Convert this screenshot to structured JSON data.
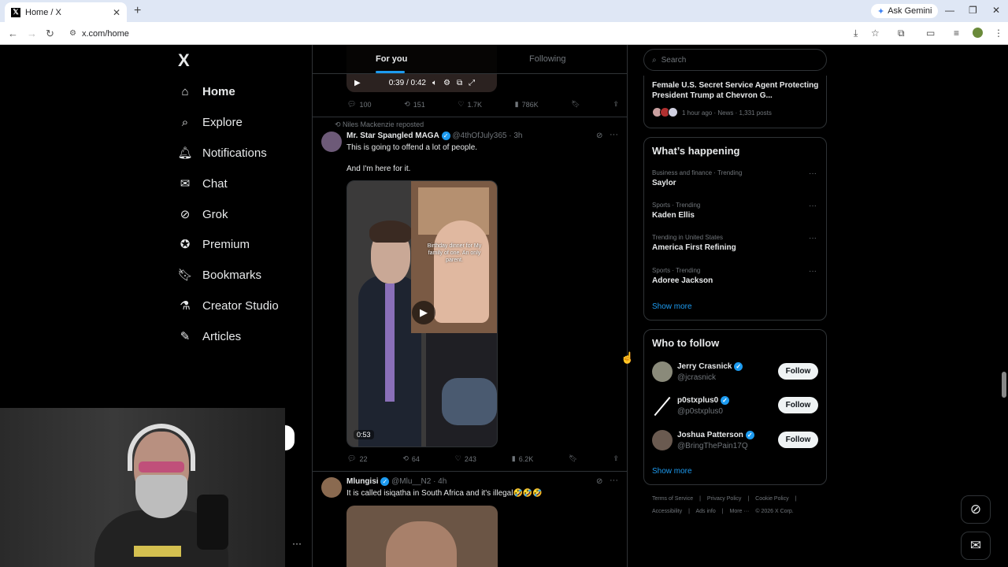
{
  "browser": {
    "tab_title": "Home / X",
    "url": "x.com/home",
    "ask_gemini": "Ask Gemini"
  },
  "nav": {
    "logo": "X",
    "items": [
      {
        "label": "Home",
        "icon": "home-icon",
        "active": true
      },
      {
        "label": "Explore",
        "icon": "search-icon"
      },
      {
        "label": "Notifications",
        "icon": "bell-icon"
      },
      {
        "label": "Chat",
        "icon": "mail-icon"
      },
      {
        "label": "Grok",
        "icon": "grok-icon"
      },
      {
        "label": "Premium",
        "icon": "verified-icon"
      },
      {
        "label": "Bookmarks",
        "icon": "bookmark-icon"
      },
      {
        "label": "Creator Studio",
        "icon": "flask-icon"
      },
      {
        "label": "Articles",
        "icon": "article-icon"
      }
    ]
  },
  "feed": {
    "tabs": {
      "for_you": "For you",
      "following": "Following"
    },
    "top_post": {
      "video_time": "0:39 / 0:42",
      "replies": "100",
      "reposts": "151",
      "likes": "1.7K",
      "views": "786K"
    },
    "post1": {
      "reposted_by": "Niles Mackenzie reposted",
      "name": "Mr. Star Spangled MAGA",
      "handle": "@4thOfJuly365",
      "time": "· 3h",
      "text1": "This is going to offend a lot of people.",
      "text2": "And I'm here for it.",
      "video_caption": "Birthday dinner for My family of one. An only parent.",
      "duration": "0:53",
      "replies": "22",
      "reposts": "64",
      "likes": "243",
      "views": "6.2K"
    },
    "post2": {
      "name": "Mlungisi",
      "handle": "@Mlu__N2",
      "time": "· 4h",
      "text": "It is called isiqatha in South Africa and it's illegal🤣🤣🤣"
    }
  },
  "right": {
    "search_placeholder": "Search",
    "news": {
      "title": "Female U.S. Secret Service Agent Protecting President Trump at Chevron G...",
      "meta": "1 hour ago · News · 1,331 posts"
    },
    "whats_happening": {
      "title": "What’s happening",
      "trends": [
        {
          "meta": "Business and finance · Trending",
          "name": "Saylor"
        },
        {
          "meta": "Sports · Trending",
          "name": "Kaden Ellis"
        },
        {
          "meta": "Trending in United States",
          "name": "America First Refining"
        },
        {
          "meta": "Sports · Trending",
          "name": "Adoree Jackson"
        }
      ],
      "show_more": "Show more"
    },
    "who_to_follow": {
      "title": "Who to follow",
      "users": [
        {
          "name": "Jerry Crasnick",
          "handle": "@jcrasnick",
          "button": "Follow"
        },
        {
          "name": "p0stxplus0",
          "handle": "@p0stxplus0",
          "button": "Follow"
        },
        {
          "name": "Joshua Patterson",
          "handle": "@BringThePain17Q",
          "button": "Follow"
        }
      ],
      "show_more": "Show more"
    },
    "footer": {
      "line1": [
        "Terms of Service",
        "|",
        "Privacy Policy",
        "|",
        "Cookie Policy",
        "|"
      ],
      "line2": [
        "Accessibility",
        "|",
        "Ads info",
        "|",
        "More ···",
        "© 2026 X Corp."
      ]
    }
  },
  "colors": {
    "accent": "#1d9bf0",
    "background": "#000000",
    "border": "#2f3336",
    "muted": "#71767b"
  }
}
